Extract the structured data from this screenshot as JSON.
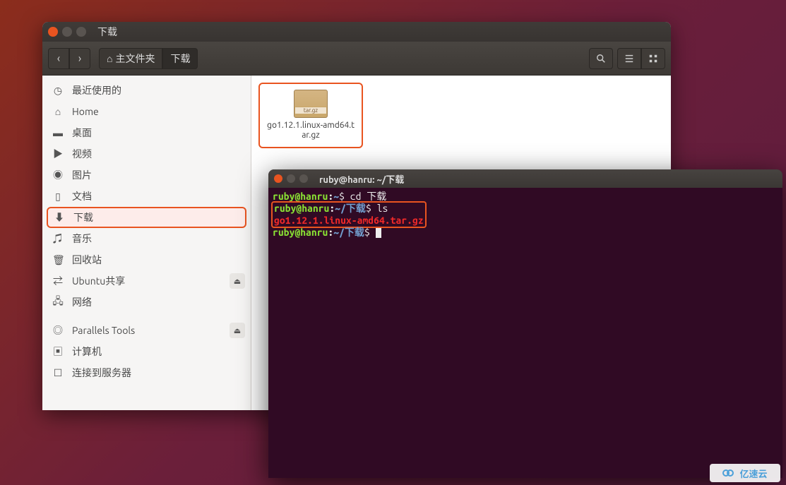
{
  "fileManager": {
    "windowTitle": "下载",
    "path": {
      "home": "主文件夹",
      "current": "下载"
    },
    "sidebar": {
      "recent": "最近使用的",
      "home": "Home",
      "desktop": "桌面",
      "videos": "视频",
      "pictures": "图片",
      "documents": "文档",
      "downloads": "下载",
      "music": "音乐",
      "trash": "回收站",
      "ubuntuShare": "Ubuntu共享",
      "network": "网络",
      "parallelsTools": "Parallels Tools",
      "computer": "计算机",
      "connectServer": "连接到服务器"
    },
    "files": [
      {
        "name": "go1.12.1.linux-amd64.tar.gz"
      }
    ]
  },
  "terminal": {
    "title": "ruby@hanru: ~/下载",
    "userHost": "ruby@hanru",
    "homePath": "~",
    "dlPath": "~/下载",
    "promptSym": "$",
    "colon": ":",
    "cmd1": "cd 下载",
    "cmd2": "ls",
    "lsOutput": "go1.12.1.linux-amd64.tar.gz"
  },
  "watermark": "亿速云"
}
